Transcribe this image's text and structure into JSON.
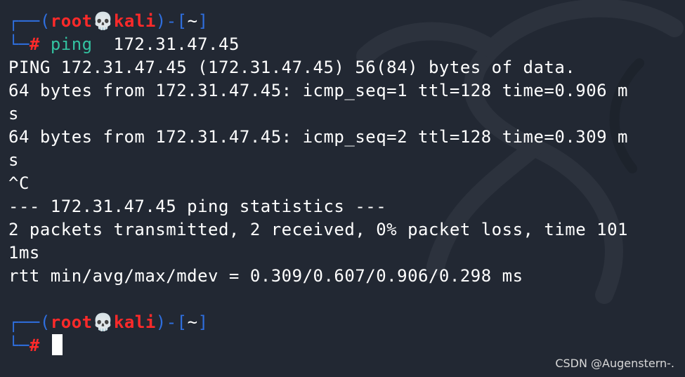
{
  "prompt1": {
    "open": "┌──(",
    "user": "root",
    "skull": "💀",
    "host": "kali",
    "mid": ")-[",
    "dir": "~",
    "close": "]",
    "corner": "└─",
    "hash": "#"
  },
  "command": {
    "name": "ping",
    "args": "  172.31.47.45"
  },
  "output": [
    "PING 172.31.47.45 (172.31.47.45) 56(84) bytes of data.",
    "64 bytes from 172.31.47.45: icmp_seq=1 ttl=128 time=0.906 m",
    "s",
    "64 bytes from 172.31.47.45: icmp_seq=2 ttl=128 time=0.309 m",
    "s",
    "^C",
    "--- 172.31.47.45 ping statistics ---",
    "2 packets transmitted, 2 received, 0% packet loss, time 101",
    "1ms",
    "rtt min/avg/max/mdev = 0.309/0.607/0.906/0.298 ms"
  ],
  "prompt2": {
    "open": "┌──(",
    "user": "root",
    "skull": "💀",
    "host": "kali",
    "mid": ")-[",
    "dir": "~",
    "close": "]",
    "corner": "└─",
    "hash": "#"
  },
  "watermark": "CSDN @Augenstern-.",
  "colors": {
    "background": "#222833",
    "prompt_box": "#2f6fdf",
    "prompt_user": "#ff2a2a",
    "command": "#33c2a0",
    "text": "#ffffff"
  }
}
